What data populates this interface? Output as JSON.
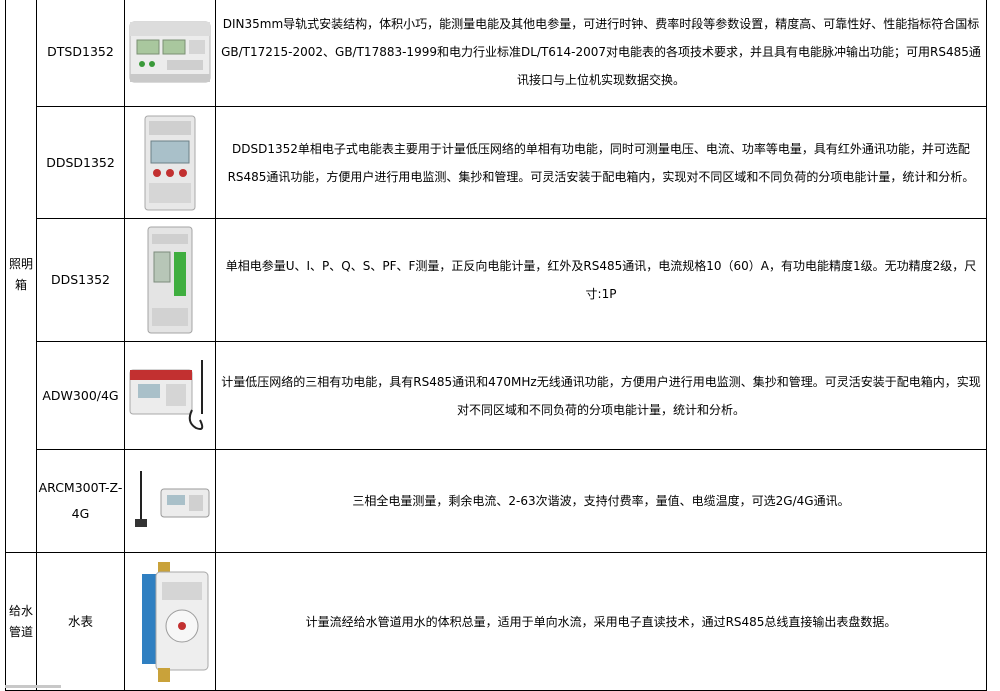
{
  "rows": [
    {
      "model": "DTSD1352",
      "desc": "DIN35mm导轨式安装结构，体积小巧，能测量电能及其他电参量，可进行时钟、费率时段等参数设置，精度高、可靠性好、性能指标符合国标GB/T17215-2002、GB/T17883-1999和电力行业标准DL/T614-2007对电能表的各项技术要求，并且具有电能脉冲输出功能；可用RS485通讯接口与上位机实现数据交换。"
    },
    {
      "model": "DDSD1352",
      "desc": "DDSD1352单相电子式电能表主要用于计量低压网络的单相有功电能，同时可测量电压、电流、功率等电量，具有红外通讯功能，并可选配RS485通讯功能，方便用户进行用电监测、集抄和管理。可灵活安装于配电箱内，实现对不同区域和不同负荷的分项电能计量，统计和分析。"
    },
    {
      "model": "DDS1352",
      "desc": "单相电参量U、I、P、Q、S、PF、F测量，正反向电能计量，红外及RS485通讯，电流规格10（60）A，有功电能精度1级。无功精度2级，尺寸:1P"
    },
    {
      "model": "ADW300/4G",
      "desc": "计量低压网络的三相有功电能，具有RS485通讯和470MHz无线通讯功能，方便用户进行用电监测、集抄和管理。可灵活安装于配电箱内，实现对不同区域和不同负荷的分项电能计量，统计和分析。"
    },
    {
      "model": "ARCM300T-Z-4G",
      "desc": "三相全电量测量，剩余电流、2-63次谐波，支持付费率，量值、电缆温度，可选2G/4G通讯。"
    },
    {
      "model": "水表",
      "desc": "计量流经给水管道用水的体积总量，适用于单向水流，采用电子直读技术，通过RS485总线直接输出表盘数据。"
    }
  ],
  "categories": {
    "lighting": "照明箱",
    "water": "给水管道"
  },
  "colors": {
    "border": "#000000",
    "green": "#3fae3f",
    "blue": "#2f7fc1",
    "brass": "#c9a23a"
  }
}
